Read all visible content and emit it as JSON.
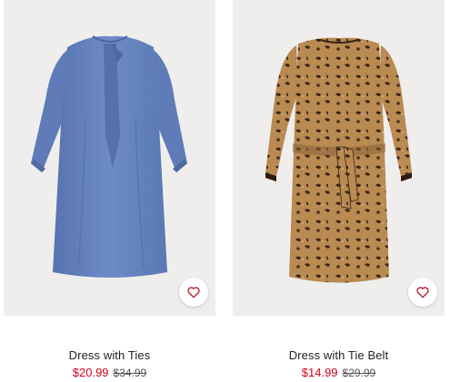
{
  "products": [
    {
      "name": "Dress with Ties",
      "sale_price": "$20.99",
      "original_price": "$34.99",
      "favorite_icon": "heart-icon"
    },
    {
      "name": "Dress with Tie Belt",
      "sale_price": "$14.99",
      "original_price": "$29.99",
      "favorite_icon": "heart-icon"
    }
  ],
  "colors": {
    "sale": "#d0021b",
    "heart": "#c0152b",
    "image_bg": "#efeeec"
  }
}
